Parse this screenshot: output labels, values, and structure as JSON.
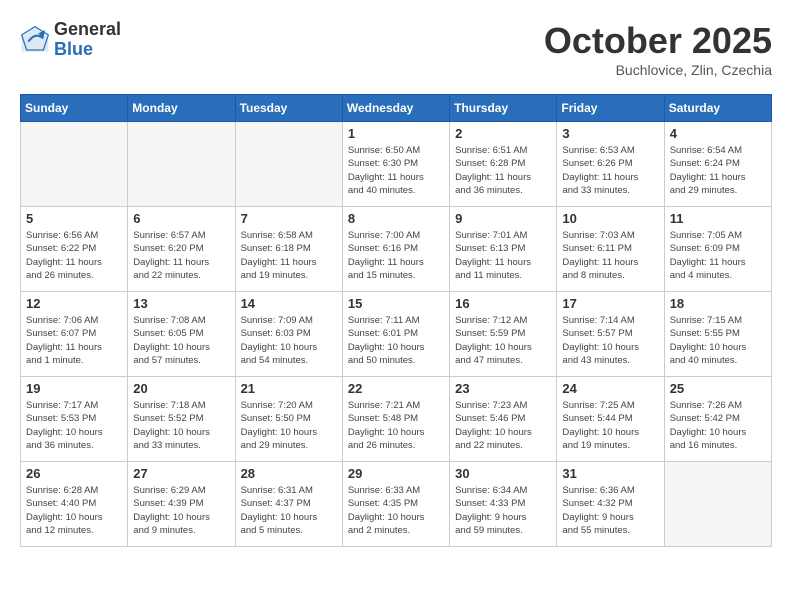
{
  "header": {
    "logo_general": "General",
    "logo_blue": "Blue",
    "month": "October 2025",
    "location": "Buchlovice, Zlin, Czechia"
  },
  "days_of_week": [
    "Sunday",
    "Monday",
    "Tuesday",
    "Wednesday",
    "Thursday",
    "Friday",
    "Saturday"
  ],
  "weeks": [
    [
      {
        "day": "",
        "info": ""
      },
      {
        "day": "",
        "info": ""
      },
      {
        "day": "",
        "info": ""
      },
      {
        "day": "1",
        "info": "Sunrise: 6:50 AM\nSunset: 6:30 PM\nDaylight: 11 hours\nand 40 minutes."
      },
      {
        "day": "2",
        "info": "Sunrise: 6:51 AM\nSunset: 6:28 PM\nDaylight: 11 hours\nand 36 minutes."
      },
      {
        "day": "3",
        "info": "Sunrise: 6:53 AM\nSunset: 6:26 PM\nDaylight: 11 hours\nand 33 minutes."
      },
      {
        "day": "4",
        "info": "Sunrise: 6:54 AM\nSunset: 6:24 PM\nDaylight: 11 hours\nand 29 minutes."
      }
    ],
    [
      {
        "day": "5",
        "info": "Sunrise: 6:56 AM\nSunset: 6:22 PM\nDaylight: 11 hours\nand 26 minutes."
      },
      {
        "day": "6",
        "info": "Sunrise: 6:57 AM\nSunset: 6:20 PM\nDaylight: 11 hours\nand 22 minutes."
      },
      {
        "day": "7",
        "info": "Sunrise: 6:58 AM\nSunset: 6:18 PM\nDaylight: 11 hours\nand 19 minutes."
      },
      {
        "day": "8",
        "info": "Sunrise: 7:00 AM\nSunset: 6:16 PM\nDaylight: 11 hours\nand 15 minutes."
      },
      {
        "day": "9",
        "info": "Sunrise: 7:01 AM\nSunset: 6:13 PM\nDaylight: 11 hours\nand 11 minutes."
      },
      {
        "day": "10",
        "info": "Sunrise: 7:03 AM\nSunset: 6:11 PM\nDaylight: 11 hours\nand 8 minutes."
      },
      {
        "day": "11",
        "info": "Sunrise: 7:05 AM\nSunset: 6:09 PM\nDaylight: 11 hours\nand 4 minutes."
      }
    ],
    [
      {
        "day": "12",
        "info": "Sunrise: 7:06 AM\nSunset: 6:07 PM\nDaylight: 11 hours\nand 1 minute."
      },
      {
        "day": "13",
        "info": "Sunrise: 7:08 AM\nSunset: 6:05 PM\nDaylight: 10 hours\nand 57 minutes."
      },
      {
        "day": "14",
        "info": "Sunrise: 7:09 AM\nSunset: 6:03 PM\nDaylight: 10 hours\nand 54 minutes."
      },
      {
        "day": "15",
        "info": "Sunrise: 7:11 AM\nSunset: 6:01 PM\nDaylight: 10 hours\nand 50 minutes."
      },
      {
        "day": "16",
        "info": "Sunrise: 7:12 AM\nSunset: 5:59 PM\nDaylight: 10 hours\nand 47 minutes."
      },
      {
        "day": "17",
        "info": "Sunrise: 7:14 AM\nSunset: 5:57 PM\nDaylight: 10 hours\nand 43 minutes."
      },
      {
        "day": "18",
        "info": "Sunrise: 7:15 AM\nSunset: 5:55 PM\nDaylight: 10 hours\nand 40 minutes."
      }
    ],
    [
      {
        "day": "19",
        "info": "Sunrise: 7:17 AM\nSunset: 5:53 PM\nDaylight: 10 hours\nand 36 minutes."
      },
      {
        "day": "20",
        "info": "Sunrise: 7:18 AM\nSunset: 5:52 PM\nDaylight: 10 hours\nand 33 minutes."
      },
      {
        "day": "21",
        "info": "Sunrise: 7:20 AM\nSunset: 5:50 PM\nDaylight: 10 hours\nand 29 minutes."
      },
      {
        "day": "22",
        "info": "Sunrise: 7:21 AM\nSunset: 5:48 PM\nDaylight: 10 hours\nand 26 minutes."
      },
      {
        "day": "23",
        "info": "Sunrise: 7:23 AM\nSunset: 5:46 PM\nDaylight: 10 hours\nand 22 minutes."
      },
      {
        "day": "24",
        "info": "Sunrise: 7:25 AM\nSunset: 5:44 PM\nDaylight: 10 hours\nand 19 minutes."
      },
      {
        "day": "25",
        "info": "Sunrise: 7:26 AM\nSunset: 5:42 PM\nDaylight: 10 hours\nand 16 minutes."
      }
    ],
    [
      {
        "day": "26",
        "info": "Sunrise: 6:28 AM\nSunset: 4:40 PM\nDaylight: 10 hours\nand 12 minutes."
      },
      {
        "day": "27",
        "info": "Sunrise: 6:29 AM\nSunset: 4:39 PM\nDaylight: 10 hours\nand 9 minutes."
      },
      {
        "day": "28",
        "info": "Sunrise: 6:31 AM\nSunset: 4:37 PM\nDaylight: 10 hours\nand 5 minutes."
      },
      {
        "day": "29",
        "info": "Sunrise: 6:33 AM\nSunset: 4:35 PM\nDaylight: 10 hours\nand 2 minutes."
      },
      {
        "day": "30",
        "info": "Sunrise: 6:34 AM\nSunset: 4:33 PM\nDaylight: 9 hours\nand 59 minutes."
      },
      {
        "day": "31",
        "info": "Sunrise: 6:36 AM\nSunset: 4:32 PM\nDaylight: 9 hours\nand 55 minutes."
      },
      {
        "day": "",
        "info": ""
      }
    ]
  ]
}
